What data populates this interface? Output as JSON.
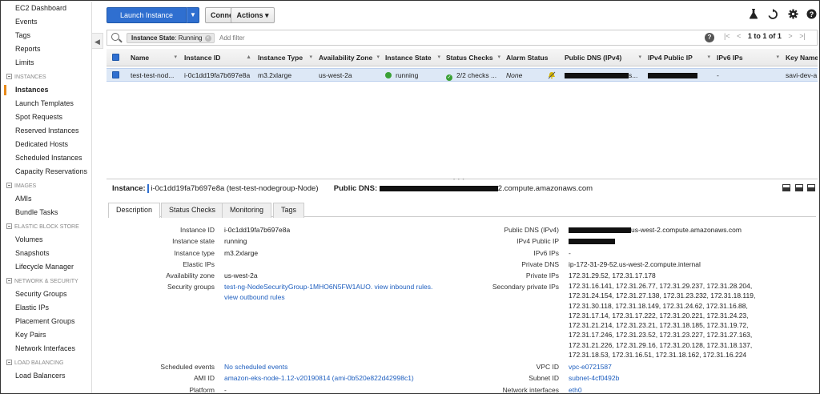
{
  "sidebar": {
    "items": [
      {
        "type": "item",
        "label": "EC2 Dashboard"
      },
      {
        "type": "item",
        "label": "Events"
      },
      {
        "type": "item",
        "label": "Tags"
      },
      {
        "type": "item",
        "label": "Reports"
      },
      {
        "type": "item",
        "label": "Limits"
      },
      {
        "type": "section",
        "label": "INSTANCES"
      },
      {
        "type": "item",
        "label": "Instances",
        "active": true
      },
      {
        "type": "item",
        "label": "Launch Templates"
      },
      {
        "type": "item",
        "label": "Spot Requests"
      },
      {
        "type": "item",
        "label": "Reserved Instances"
      },
      {
        "type": "item",
        "label": "Dedicated Hosts"
      },
      {
        "type": "item",
        "label": "Scheduled Instances"
      },
      {
        "type": "item",
        "label": "Capacity Reservations"
      },
      {
        "type": "section",
        "label": "IMAGES"
      },
      {
        "type": "item",
        "label": "AMIs"
      },
      {
        "type": "item",
        "label": "Bundle Tasks"
      },
      {
        "type": "section",
        "label": "ELASTIC BLOCK STORE"
      },
      {
        "type": "item",
        "label": "Volumes"
      },
      {
        "type": "item",
        "label": "Snapshots"
      },
      {
        "type": "item",
        "label": "Lifecycle Manager"
      },
      {
        "type": "section",
        "label": "NETWORK & SECURITY"
      },
      {
        "type": "item",
        "label": "Security Groups"
      },
      {
        "type": "item",
        "label": "Elastic IPs"
      },
      {
        "type": "item",
        "label": "Placement Groups"
      },
      {
        "type": "item",
        "label": "Key Pairs"
      },
      {
        "type": "item",
        "label": "Network Interfaces"
      },
      {
        "type": "section",
        "label": "LOAD BALANCING"
      },
      {
        "type": "item",
        "label": "Load Balancers"
      }
    ],
    "collapse_glyph": "◀"
  },
  "toolbar": {
    "launch_label": "Launch Instance",
    "caret": "▼",
    "connect_label": "Connect",
    "actions_label": "Actions ▾",
    "icons": [
      "flask-icon",
      "refresh-icon",
      "gear-icon",
      "help-icon"
    ]
  },
  "search": {
    "chip_key": "Instance State",
    "chip_value": ": Running",
    "chip_remove": "×",
    "placeholder": "Add filter",
    "help": "?",
    "pager_first": "|<",
    "pager_prev": "<",
    "pager_text": "1 to 1 of 1",
    "pager_next": ">",
    "pager_last": ">|"
  },
  "table": {
    "columns": [
      "Name",
      "Instance ID",
      "Instance Type",
      "Availability Zone",
      "Instance State",
      "Status Checks",
      "Alarm Status",
      "Public DNS (IPv4)",
      "IPv4 Public IP",
      "IPv6 IPs",
      "Key Name"
    ],
    "sort_markers": [
      "▾",
      "▲",
      "▾",
      "▾",
      "▾",
      "▾",
      "",
      "▾",
      "▾",
      "▾",
      ""
    ],
    "row": {
      "name": "test-test-nod...",
      "instance_id": "i-0c1dd19fa7b697e8a",
      "instance_type": "m3.2xlarge",
      "availability_zone": "us-west-2a",
      "instance_state": "running",
      "status_checks": "2/2 checks ...",
      "alarm_status": "None",
      "public_dns_suffix": "s...",
      "ipv6": "-",
      "key_name": "savi-dev-a"
    }
  },
  "detail": {
    "instance_label": "Instance:",
    "instance_value": "i-0c1dd19fa7b697e8a (test-test-nodegroup-Node)",
    "dns_label": "Public DNS:",
    "dns_suffix": "2.compute.amazonaws.com",
    "tabs": [
      "Description",
      "Status Checks",
      "Monitoring",
      "Tags"
    ],
    "left": [
      {
        "label": "Instance ID",
        "value": "i-0c1dd19fa7b697e8a"
      },
      {
        "label": "Instance state",
        "value": "running"
      },
      {
        "label": "Instance type",
        "value": "m3.2xlarge"
      },
      {
        "label": "Elastic IPs",
        "value": ""
      },
      {
        "label": "Availability zone",
        "value": "us-west-2a"
      },
      {
        "label": "Security groups",
        "value": "test-ng-NodeSecurityGroup-1MHO6N5FW1AUO.",
        "link2": "view inbound rules.",
        "link3": "view outbound rules"
      }
    ],
    "left_bottom": [
      {
        "label": "Scheduled events",
        "value": "No scheduled events"
      },
      {
        "label": "AMI ID",
        "value": "amazon-eks-node-1.12-v20190814 (ami-0b520e822d42998c1)"
      },
      {
        "label": "Platform",
        "value": "-"
      }
    ],
    "right": [
      {
        "label": "Public DNS (IPv4)",
        "value": "us-west-2.compute.amazonaws.com"
      },
      {
        "label": "IPv4 Public IP",
        "value": ""
      },
      {
        "label": "IPv6 IPs",
        "value": "-"
      },
      {
        "label": "Private DNS",
        "value": "ip-172-31-29-52.us-west-2.compute.internal"
      },
      {
        "label": "Private IPs",
        "value": "172.31.29.52, 172.31.17.178"
      },
      {
        "label": "Secondary private IPs",
        "value": ""
      }
    ],
    "secondary_ips": [
      "172.31.16.141, 172.31.26.77, 172.31.29.237, 172.31.28.204,",
      "172.31.24.154, 172.31.27.138, 172.31.23.232, 172.31.18.119,",
      "172.31.30.118, 172.31.18.149, 172.31.24.62, 172.31.16.88,",
      "172.31.17.14, 172.31.17.222, 172.31.20.221, 172.31.24.23,",
      "172.31.21.214, 172.31.23.21, 172.31.18.185, 172.31.19.72,",
      "172.31.17.246, 172.31.23.52, 172.31.23.227, 172.31.27.163,",
      "172.31.21.226, 172.31.29.16, 172.31.20.128, 172.31.18.137,",
      "172.31.18.53, 172.31.16.51, 172.31.18.162, 172.31.16.224"
    ],
    "right_bottom": [
      {
        "label": "VPC ID",
        "value": "vpc-e0721587"
      },
      {
        "label": "Subnet ID",
        "value": "subnet-4cf0492b"
      },
      {
        "label": "Network interfaces",
        "value": "eth0"
      }
    ]
  }
}
